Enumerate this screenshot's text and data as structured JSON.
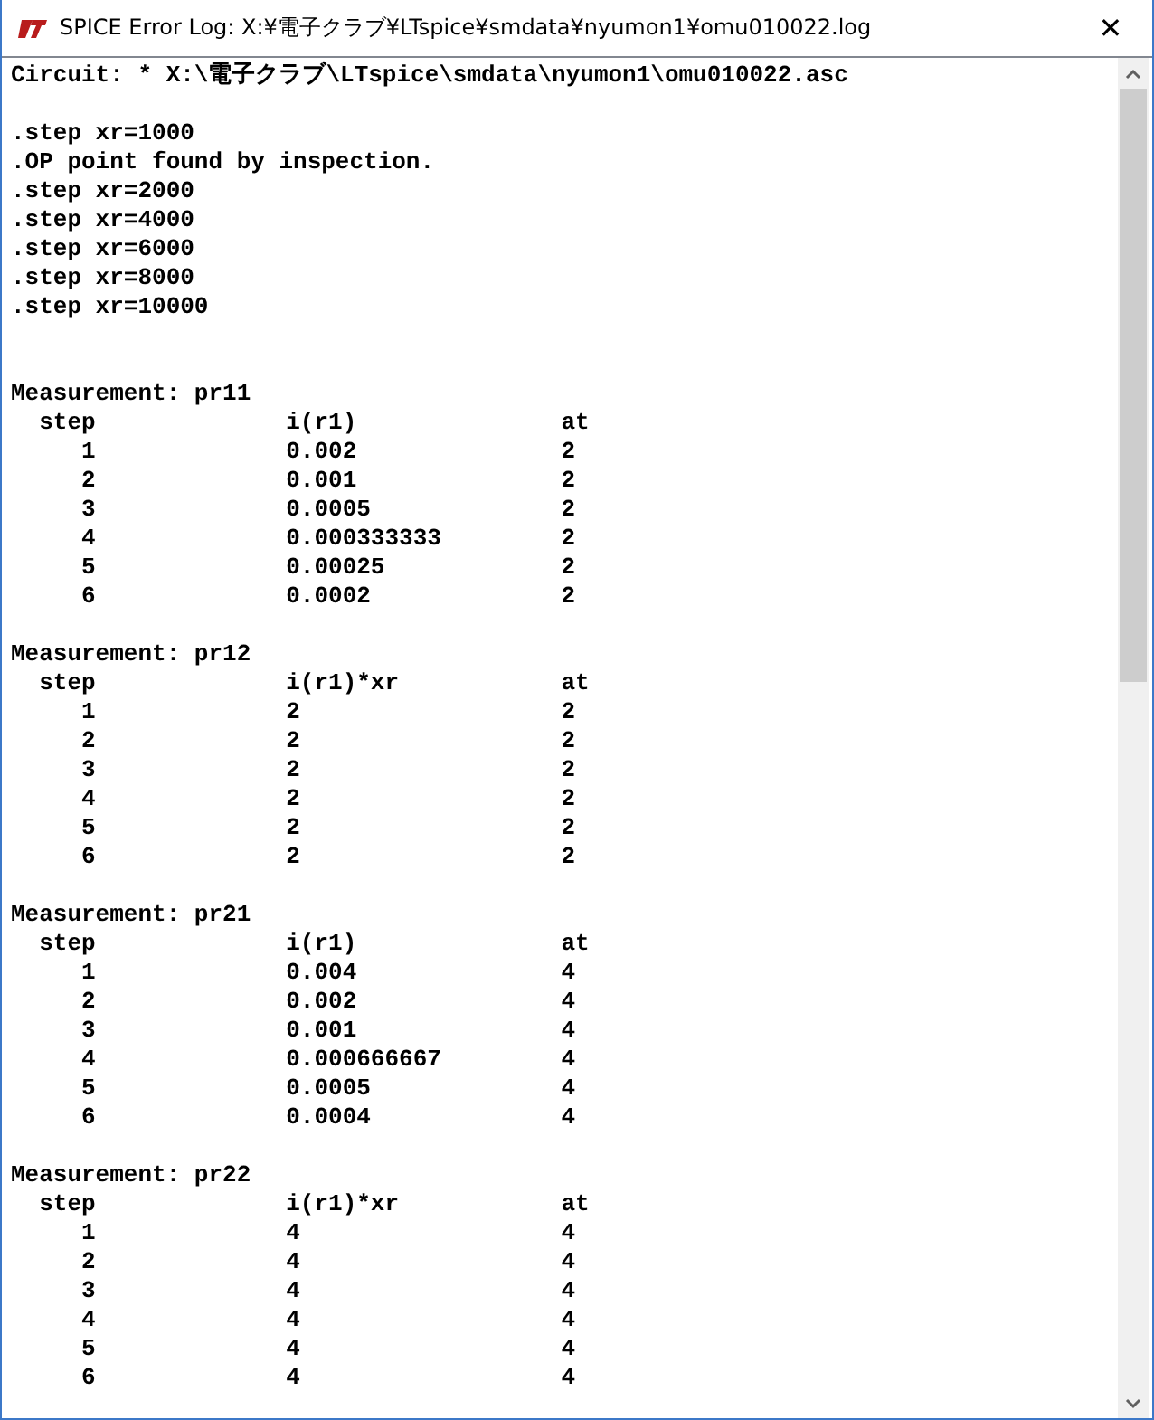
{
  "window": {
    "title": "SPICE Error Log: X:¥電子クラブ¥LTspice¥smdata¥nyumon1¥omu010022.log",
    "close": "✕"
  },
  "log": {
    "circuit": "Circuit: * X:\\電子クラブ\\LTspice\\smdata\\nyumon1\\omu010022.asc",
    "lines": [
      ".step xr=1000",
      ".OP point found by inspection.",
      ".step xr=2000",
      ".step xr=4000",
      ".step xr=6000",
      ".step xr=8000",
      ".step xr=10000"
    ],
    "measurements": [
      {
        "title": "Measurement: pr11",
        "columns": [
          "step",
          "i(r1)",
          "at"
        ],
        "rows": [
          [
            "1",
            "0.002",
            "2"
          ],
          [
            "2",
            "0.001",
            "2"
          ],
          [
            "3",
            "0.0005",
            "2"
          ],
          [
            "4",
            "0.000333333",
            "2"
          ],
          [
            "5",
            "0.00025",
            "2"
          ],
          [
            "6",
            "0.0002",
            "2"
          ]
        ]
      },
      {
        "title": "Measurement: pr12",
        "columns": [
          "step",
          "i(r1)*xr",
          "at"
        ],
        "rows": [
          [
            "1",
            "2",
            "2"
          ],
          [
            "2",
            "2",
            "2"
          ],
          [
            "3",
            "2",
            "2"
          ],
          [
            "4",
            "2",
            "2"
          ],
          [
            "5",
            "2",
            "2"
          ],
          [
            "6",
            "2",
            "2"
          ]
        ]
      },
      {
        "title": "Measurement: pr21",
        "columns": [
          "step",
          "i(r1)",
          "at"
        ],
        "rows": [
          [
            "1",
            "0.004",
            "4"
          ],
          [
            "2",
            "0.002",
            "4"
          ],
          [
            "3",
            "0.001",
            "4"
          ],
          [
            "4",
            "0.000666667",
            "4"
          ],
          [
            "5",
            "0.0005",
            "4"
          ],
          [
            "6",
            "0.0004",
            "4"
          ]
        ]
      },
      {
        "title": "Measurement: pr22",
        "columns": [
          "step",
          "i(r1)*xr",
          "at"
        ],
        "rows": [
          [
            "1",
            "4",
            "4"
          ],
          [
            "2",
            "4",
            "4"
          ],
          [
            "3",
            "4",
            "4"
          ],
          [
            "4",
            "4",
            "4"
          ],
          [
            "5",
            "4",
            "4"
          ],
          [
            "6",
            "4",
            "4"
          ]
        ]
      }
    ]
  }
}
